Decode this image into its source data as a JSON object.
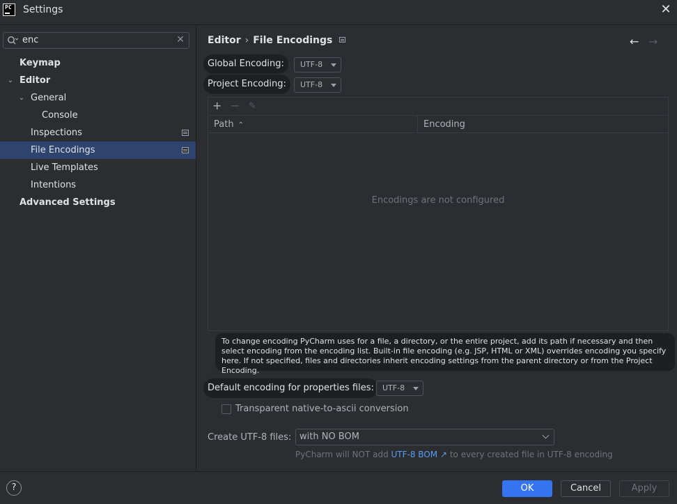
{
  "window": {
    "title": "Settings",
    "logo_text": "PC"
  },
  "search": {
    "value": "enc"
  },
  "tree": {
    "items": [
      {
        "label": "Keymap"
      },
      {
        "label": "Editor"
      },
      {
        "label": "General"
      },
      {
        "label": "Console"
      },
      {
        "label": "Inspections"
      },
      {
        "label": "File Encodings"
      },
      {
        "label": "Live Templates"
      },
      {
        "label": "Intentions"
      },
      {
        "label": "Advanced Settings"
      }
    ]
  },
  "breadcrumb": {
    "parent": "Editor",
    "current": "File Encodings"
  },
  "global_encoding": {
    "label": "Global Encoding:",
    "value": "UTF-8"
  },
  "project_encoding": {
    "label": "Project Encoding:",
    "value": "UTF-8"
  },
  "table": {
    "columns": [
      "Path",
      "Encoding"
    ],
    "empty_text": "Encodings are not configured"
  },
  "hint": {
    "text": "To change encoding PyCharm uses for a file, a directory, or the entire project, add its path if necessary and then select encoding from the encoding list. Built-in file encoding (e.g. JSP, HTML or XML) overrides encoding you specify here. If not specified, files and directories inherit encoding settings from the parent directory or from the Project Encoding."
  },
  "properties_encoding": {
    "label": "Default encoding for properties files:",
    "value": "UTF-8"
  },
  "native_to_ascii": {
    "label": "Transparent native-to-ascii conversion",
    "checked": false
  },
  "create_utf8": {
    "label": "Create UTF-8 files:",
    "value": "with NO BOM",
    "note_prefix": "PyCharm will NOT add",
    "note_link": "UTF-8 BOM ↗",
    "note_suffix": "to every created file in UTF-8 encoding"
  },
  "footer": {
    "help_label": "?",
    "ok_label": "OK",
    "cancel_label": "Cancel",
    "apply_label": "Apply"
  },
  "colors": {
    "background": "#2b2d30",
    "selection": "#2e436e",
    "primary_button": "#3574f0",
    "link": "#589df6"
  }
}
